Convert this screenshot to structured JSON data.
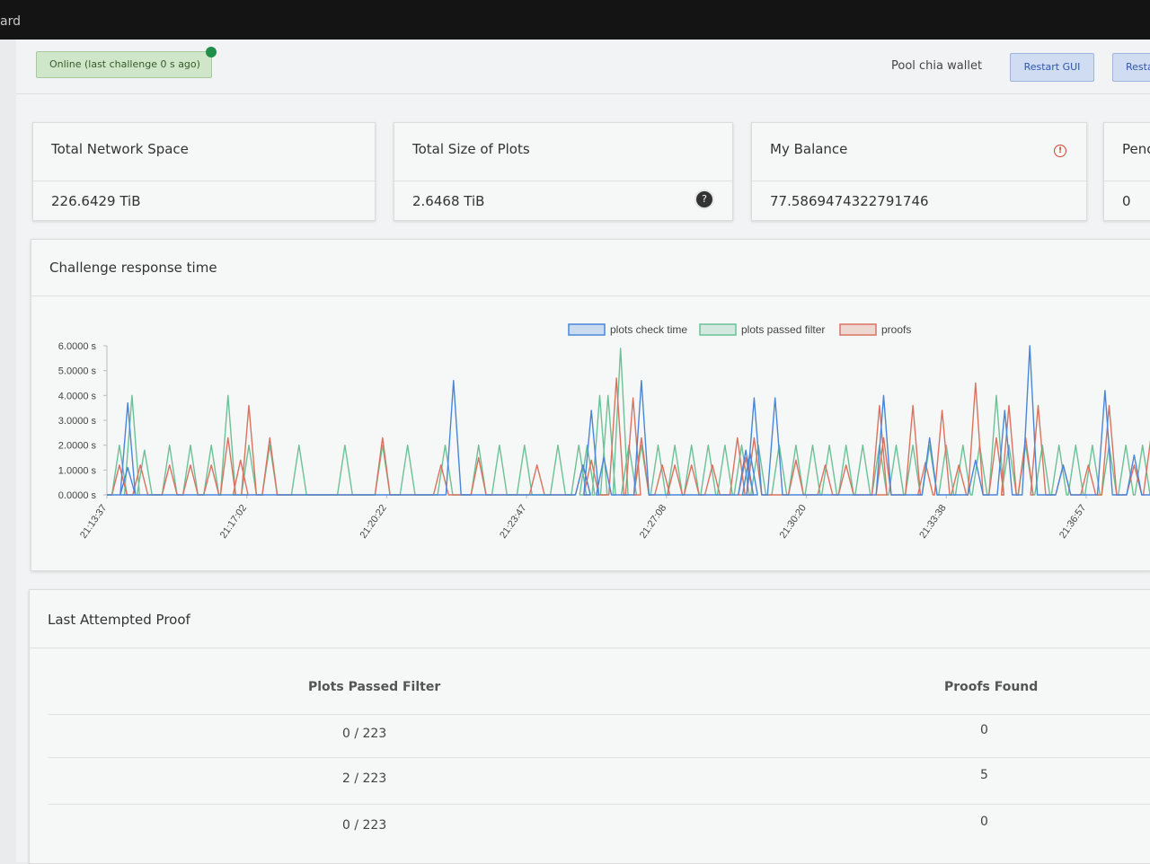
{
  "window": {
    "title_fragment": "ard"
  },
  "status": {
    "online_text": "Online (last challenge 0 s ago)"
  },
  "header": {
    "wallet_label": "Pool chia wallet",
    "restart_gui": "Restart GUI",
    "restart_2": "Resta"
  },
  "stats": [
    {
      "title": "Total Network Space",
      "value": "226.6429 TiB"
    },
    {
      "title": "Total Size of Plots",
      "value": "2.6468 TiB"
    },
    {
      "title": "My Balance",
      "value": "77.5869474322791746"
    },
    {
      "title": "Penc",
      "value": "0"
    }
  ],
  "icons": {
    "help": "question-circle-icon",
    "warning": "alert-circle-icon",
    "online": "status-dot-icon"
  },
  "colors": {
    "plots_check_time": "#4a86d8",
    "plots_passed_filter": "#6cc196",
    "proofs": "#d9735f",
    "online_dot": "#1f8f4a",
    "button_bg": "#cfdcf2"
  },
  "chart": {
    "title": "Challenge response time"
  },
  "chart_data": {
    "type": "line",
    "title": "Challenge response time",
    "ylim": [
      0,
      6
    ],
    "y_ticks": [
      "0.0000 s",
      "1.0000 s",
      "2.0000 s",
      "3.0000 s",
      "4.0000 s",
      "5.0000 s",
      "6.0000 s"
    ],
    "x_ticks": [
      "21:13:37",
      "21:17:02",
      "21:20:22",
      "21:23:47",
      "21:27:08",
      "21:30:20",
      "21:33:38",
      "21:36:57"
    ],
    "x_range_minutes": [
      0,
      25
    ],
    "legend_position": "top-center",
    "grid": false,
    "series": [
      {
        "name": "plots check time",
        "peaks": [
          [
            0.5,
            1.1
          ],
          [
            0.5,
            3.7
          ],
          [
            8.3,
            4.6
          ],
          [
            11.4,
            1.2
          ],
          [
            11.6,
            3.4
          ],
          [
            11.9,
            1.5
          ],
          [
            12.8,
            4.6
          ],
          [
            15.3,
            1.8
          ],
          [
            15.4,
            1.7
          ],
          [
            15.5,
            3.9
          ],
          [
            16.0,
            3.9
          ],
          [
            18.6,
            4.0
          ],
          [
            19.7,
            2.3
          ],
          [
            20.8,
            1.4
          ],
          [
            21.5,
            3.4
          ],
          [
            22.1,
            6.0
          ],
          [
            22.9,
            1.2
          ],
          [
            23.9,
            4.2
          ],
          [
            24.6,
            1.6
          ]
        ]
      },
      {
        "name": "plots passed filter",
        "peaks": [
          [
            0.3,
            2.0
          ],
          [
            0.6,
            4.0
          ],
          [
            0.9,
            1.8
          ],
          [
            1.5,
            2.0
          ],
          [
            2.0,
            2.0
          ],
          [
            2.5,
            2.0
          ],
          [
            2.9,
            4.0
          ],
          [
            3.4,
            2.0
          ],
          [
            3.9,
            2.0
          ],
          [
            4.6,
            2.0
          ],
          [
            5.7,
            2.0
          ],
          [
            6.6,
            2.0
          ],
          [
            7.2,
            2.0
          ],
          [
            8.1,
            2.0
          ],
          [
            8.9,
            2.0
          ],
          [
            9.4,
            2.0
          ],
          [
            10.0,
            2.0
          ],
          [
            10.8,
            2.0
          ],
          [
            11.3,
            2.0
          ],
          [
            11.5,
            2.0
          ],
          [
            11.8,
            4.0
          ],
          [
            12.0,
            4.0
          ],
          [
            12.3,
            5.9
          ],
          [
            12.5,
            2.0
          ],
          [
            12.8,
            2.0
          ],
          [
            13.2,
            2.0
          ],
          [
            13.6,
            2.0
          ],
          [
            14.0,
            2.0
          ],
          [
            14.4,
            2.0
          ],
          [
            14.8,
            2.0
          ],
          [
            15.2,
            2.0
          ],
          [
            15.6,
            2.0
          ],
          [
            16.1,
            2.0
          ],
          [
            16.5,
            2.0
          ],
          [
            16.9,
            2.0
          ],
          [
            17.3,
            2.0
          ],
          [
            17.7,
            2.0
          ],
          [
            18.1,
            2.0
          ],
          [
            18.5,
            2.0
          ],
          [
            18.9,
            2.0
          ],
          [
            19.3,
            2.0
          ],
          [
            19.7,
            2.0
          ],
          [
            20.1,
            2.0
          ],
          [
            20.5,
            2.0
          ],
          [
            20.9,
            2.0
          ],
          [
            21.3,
            4.0
          ],
          [
            21.6,
            2.0
          ],
          [
            22.0,
            2.0
          ],
          [
            22.4,
            2.0
          ],
          [
            22.8,
            2.0
          ],
          [
            23.2,
            2.0
          ],
          [
            23.6,
            2.0
          ],
          [
            24.0,
            2.0
          ],
          [
            24.4,
            2.0
          ],
          [
            24.8,
            2.0
          ]
        ]
      },
      {
        "name": "proofs",
        "peaks": [
          [
            0.3,
            1.2
          ],
          [
            0.8,
            1.2
          ],
          [
            1.5,
            1.2
          ],
          [
            2.0,
            1.2
          ],
          [
            2.5,
            1.2
          ],
          [
            2.9,
            2.3
          ],
          [
            3.2,
            1.4
          ],
          [
            3.4,
            3.6
          ],
          [
            3.9,
            2.3
          ],
          [
            6.6,
            2.3
          ],
          [
            8.0,
            1.2
          ],
          [
            8.9,
            1.5
          ],
          [
            10.3,
            1.2
          ],
          [
            11.4,
            1.2
          ],
          [
            11.6,
            1.4
          ],
          [
            12.2,
            4.7
          ],
          [
            12.6,
            3.9
          ],
          [
            12.8,
            2.3
          ],
          [
            13.3,
            1.2
          ],
          [
            13.6,
            1.2
          ],
          [
            14.0,
            1.2
          ],
          [
            14.5,
            1.2
          ],
          [
            15.1,
            2.3
          ],
          [
            15.3,
            1.5
          ],
          [
            15.5,
            2.3
          ],
          [
            16.5,
            1.4
          ],
          [
            17.2,
            1.2
          ],
          [
            17.7,
            1.2
          ],
          [
            18.5,
            3.6
          ],
          [
            18.6,
            2.3
          ],
          [
            19.3,
            3.6
          ],
          [
            19.6,
            1.3
          ],
          [
            20.0,
            3.4
          ],
          [
            20.4,
            1.2
          ],
          [
            20.8,
            4.5
          ],
          [
            21.3,
            2.3
          ],
          [
            21.6,
            3.6
          ],
          [
            22.0,
            2.3
          ],
          [
            22.3,
            3.6
          ],
          [
            22.9,
            1.2
          ],
          [
            23.5,
            1.2
          ],
          [
            24.0,
            3.6
          ],
          [
            24.6,
            1.2
          ],
          [
            25.0,
            2.3
          ]
        ]
      }
    ]
  },
  "proof": {
    "title": "Last Attempted Proof",
    "columns": [
      "Plots Passed Filter",
      "Proofs Found"
    ],
    "rows": [
      [
        "0 / 223",
        "0"
      ],
      [
        "2 / 223",
        "5"
      ],
      [
        "0 / 223",
        "0"
      ]
    ]
  }
}
